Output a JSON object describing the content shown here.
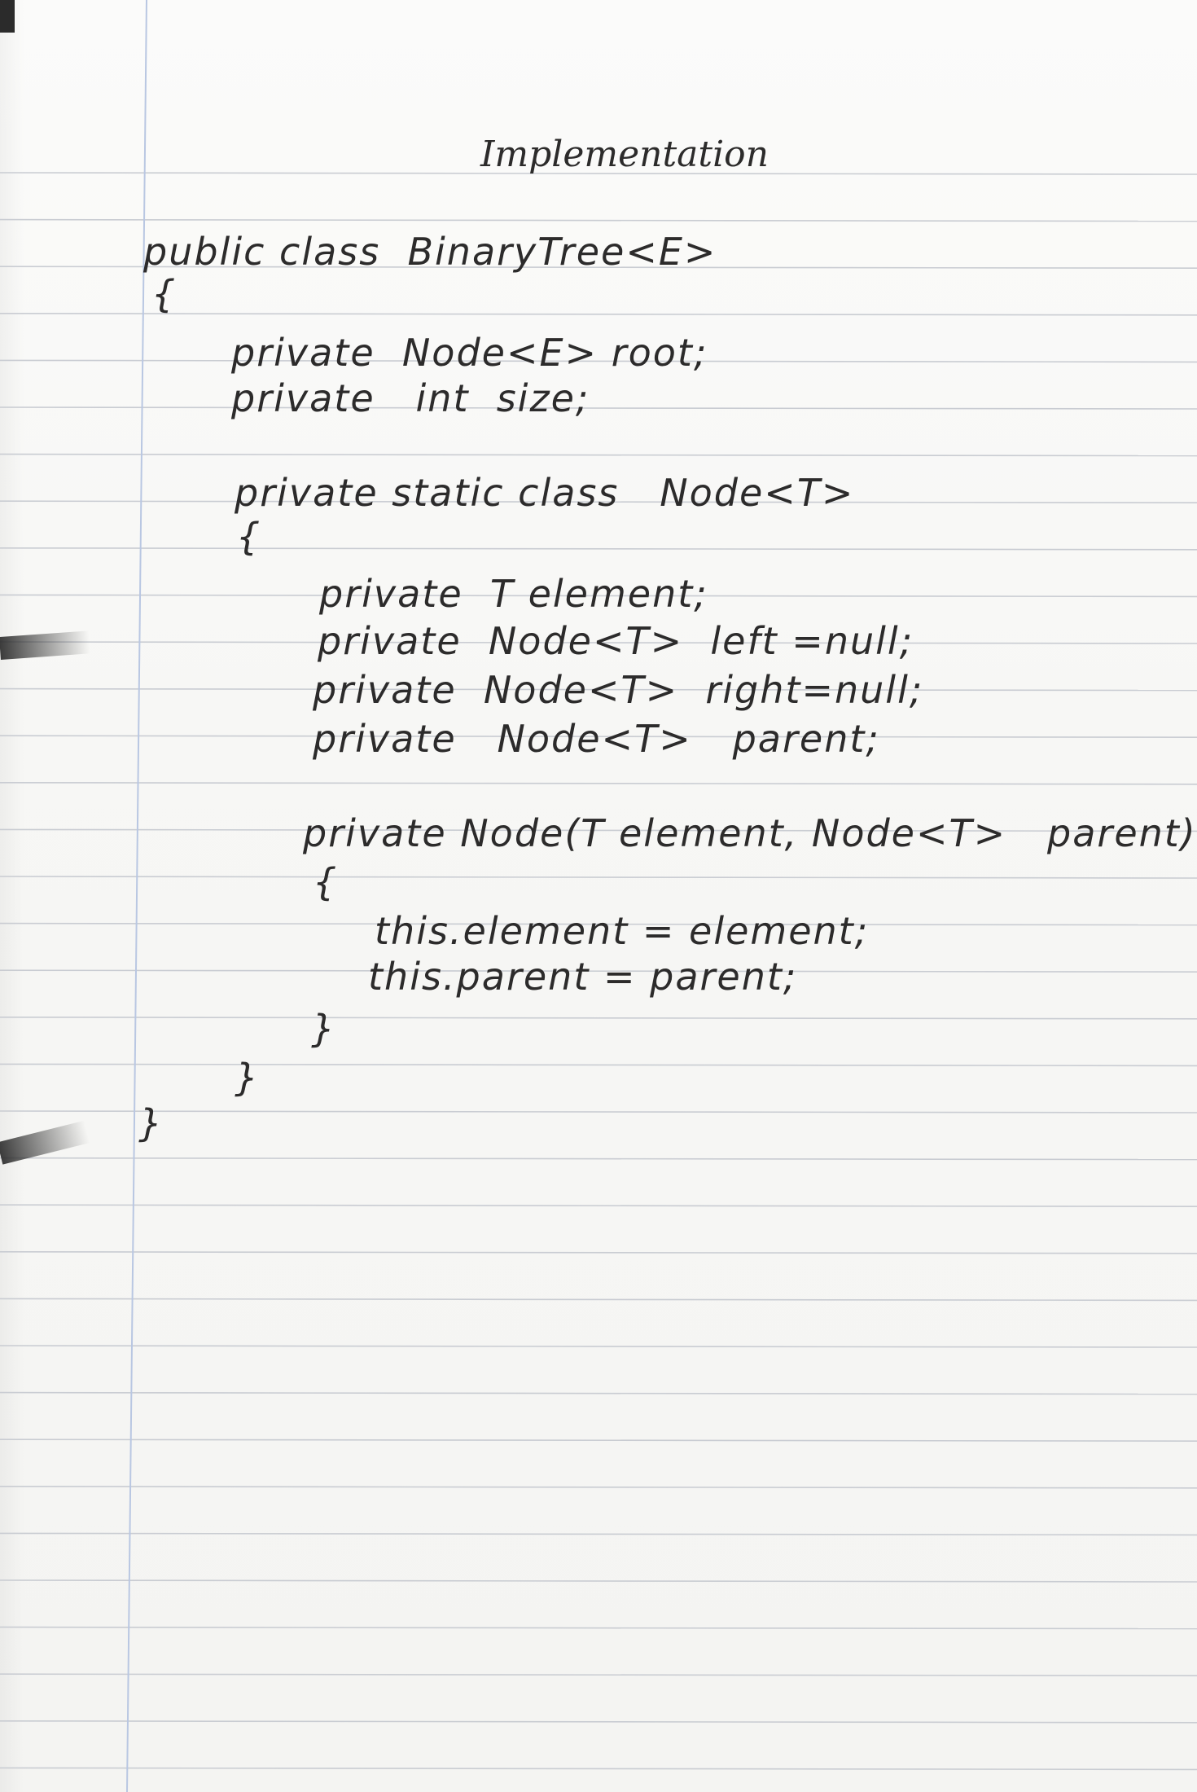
{
  "title": "Implementation",
  "code": {
    "class_decl": "public class  BinaryTree<E>",
    "class_open": "{",
    "field_root": "private  Node<E> root;",
    "field_size": "private   int  size;",
    "inner_decl": "private static class   Node<T>",
    "inner_open": "{",
    "field_element": "private  T element;",
    "field_left": "private  Node<T>  left =null;",
    "field_right": "private  Node<T>  right=null;",
    "field_parent": "private   Node<T>   parent;",
    "ctor_decl": "private Node(T element, Node<T>   parent)",
    "ctor_open": "{",
    "assign_element": "this.element = element;",
    "assign_parent": "this.parent = parent;",
    "ctor_close": "}",
    "inner_close": "}",
    "class_close": "}"
  },
  "colors": {
    "ink": "#2c2b2b",
    "rule_line": "#c9ccd2",
    "margin_line": "#b9c7e2",
    "paper": "#f7f7f5"
  }
}
